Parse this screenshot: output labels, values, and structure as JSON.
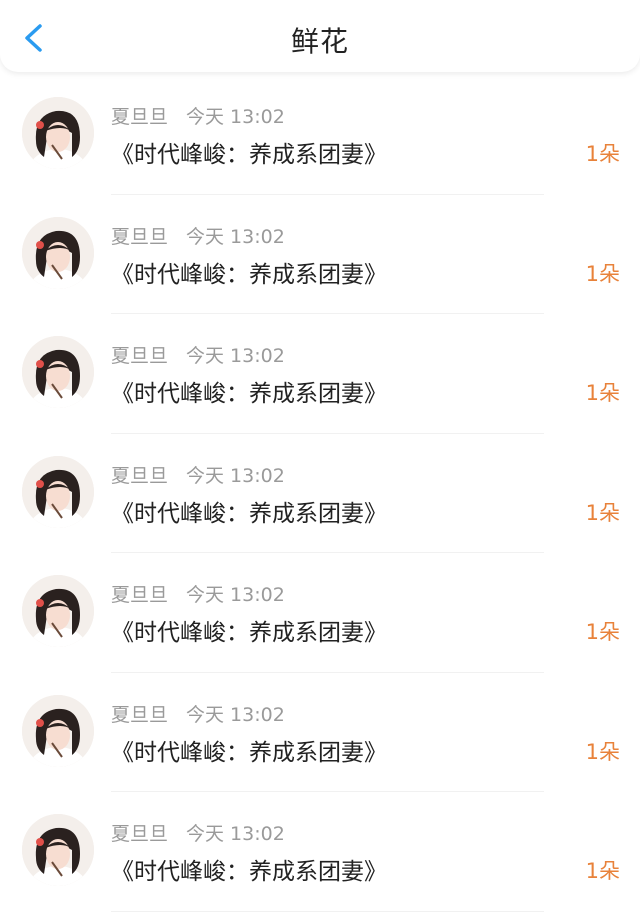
{
  "header": {
    "title": "鲜花",
    "back_icon": "chevron-left-icon",
    "accent_color": "#2a9bf0"
  },
  "list": {
    "items": [
      {
        "user_name": "夏旦旦",
        "time": "今天 13:02",
        "book_title": "《时代峰峻：养成系团妻》",
        "count": "1朵"
      },
      {
        "user_name": "夏旦旦",
        "time": "今天 13:02",
        "book_title": "《时代峰峻：养成系团妻》",
        "count": "1朵"
      },
      {
        "user_name": "夏旦旦",
        "time": "今天 13:02",
        "book_title": "《时代峰峻：养成系团妻》",
        "count": "1朵"
      },
      {
        "user_name": "夏旦旦",
        "time": "今天 13:02",
        "book_title": "《时代峰峻：养成系团妻》",
        "count": "1朵"
      },
      {
        "user_name": "夏旦旦",
        "time": "今天 13:02",
        "book_title": "《时代峰峻：养成系团妻》",
        "count": "1朵"
      },
      {
        "user_name": "夏旦旦",
        "time": "今天 13:02",
        "book_title": "《时代峰峻：养成系团妻》",
        "count": "1朵"
      },
      {
        "user_name": "夏旦旦",
        "time": "今天 13:02",
        "book_title": "《时代峰峻：养成系团妻》",
        "count": "1朵"
      }
    ]
  },
  "colors": {
    "count": "#e8823a",
    "meta_text": "#9a9a9a",
    "primary_text": "#222222"
  }
}
